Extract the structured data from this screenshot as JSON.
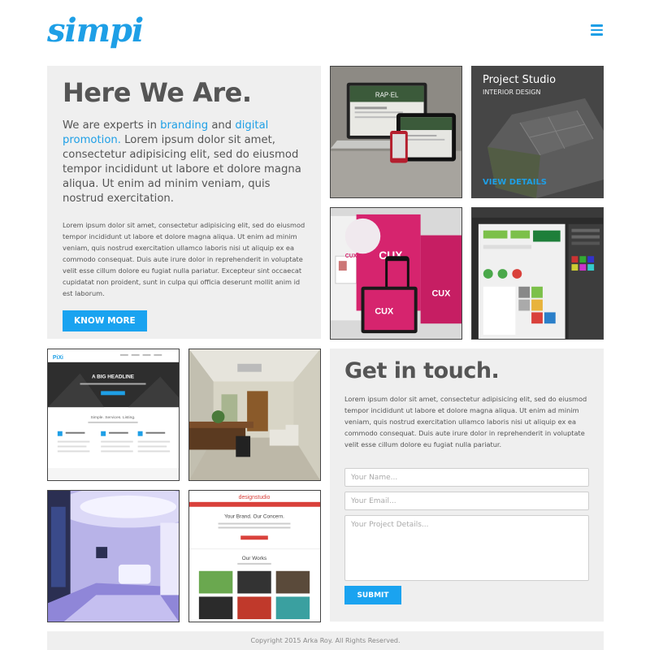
{
  "header": {
    "logo": "simpi",
    "menu_icon": "hamburger-menu-icon"
  },
  "intro": {
    "title": "Here We Are.",
    "lead_prefix": "We are experts in ",
    "lead_link1": "branding",
    "lead_mid": " and ",
    "lead_link2": "digital promotion.",
    "lead_rest": " Lorem ipsum dolor sit amet, consectetur adipisicing elit, sed do eiusmod tempor incididunt ut labore et dolore magna aliqua. Ut enim ad minim veniam, quis nostrud exercitation.",
    "body": "Lorem ipsum dolor sit amet, consectetur adipisicing elit, sed do eiusmod tempor incididunt ut labore et dolore magna aliqua. Ut enim ad minim veniam, quis nostrud exercitation ullamco laboris nisi ut aliquip ex ea commodo consequat. Duis aute irure dolor in reprehenderit in voluptate velit esse cillum dolore eu fugiat nulla pariatur. Excepteur sint occaecat cupidatat non proident, sunt in culpa qui officia deserunt mollit anim id est laborum.",
    "button": "KNOW MORE"
  },
  "portfolio": {
    "laptop_brand": "RAP·EL",
    "brand_cux": "CUX",
    "studio_title": "Project Studio",
    "studio_subtitle": "INTERIOR DESIGN",
    "studio_link": "VIEW DETAILS",
    "pixi_logo": "PiXi",
    "pixi_headline": "A BIG HEADLINE",
    "pixi_tagline": "Simple. Services. Listing.",
    "design_logo": "designstudio",
    "design_tagline": "Your Brand. Our Concern.",
    "design_works": "Our Works"
  },
  "contact": {
    "title": "Get in touch.",
    "body": "Lorem ipsum dolor sit amet, consectetur adipisicing elit, sed do eiusmod tempor incididunt ut labore et dolore magna aliqua. Ut enim ad minim veniam, quis nostrud exercitation ullamco laboris nisi ut aliquip ex ea commodo consequat. Duis aute irure dolor in reprehenderit in voluptate velit esse cillum dolore eu fugiat nulla pariatur.",
    "name_placeholder": "Your Name...",
    "email_placeholder": "Your Email...",
    "details_placeholder": "Your Project Details...",
    "submit": "SUBMIT"
  },
  "footer": {
    "copyright": "Copyright 2015 Arka Roy. All Rights Reserved."
  },
  "colors": {
    "accent": "#1e9fe6",
    "panel": "#efefef",
    "text": "#555555"
  }
}
